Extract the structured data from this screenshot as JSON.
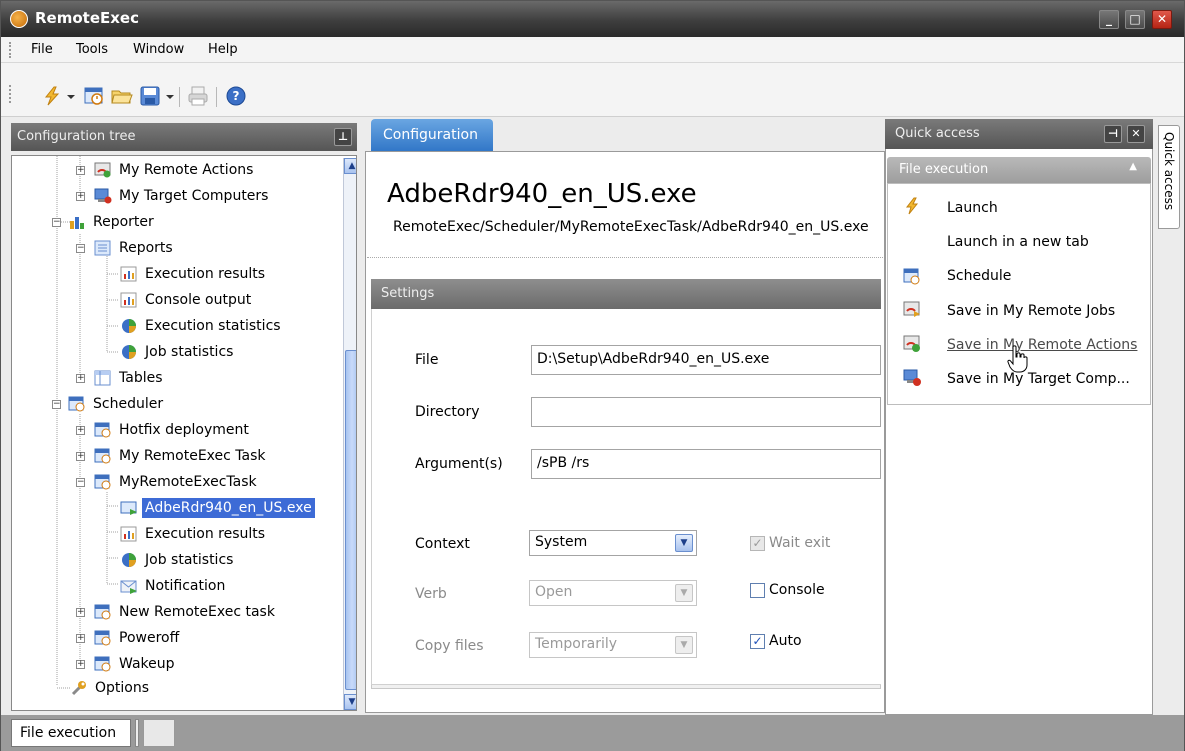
{
  "window": {
    "title": "RemoteExec"
  },
  "menu": [
    "File",
    "Tools",
    "Window",
    "Help"
  ],
  "tree_panel": {
    "title": "Configuration tree"
  },
  "tree": [
    {
      "label": "My Remote Actions"
    },
    {
      "label": "My Target Computers"
    },
    {
      "label": "Reporter"
    },
    {
      "label": "Reports"
    },
    {
      "label": "Execution results"
    },
    {
      "label": "Console output"
    },
    {
      "label": "Execution statistics"
    },
    {
      "label": "Job statistics"
    },
    {
      "label": "Tables"
    },
    {
      "label": "Scheduler"
    },
    {
      "label": "Hotfix deployment"
    },
    {
      "label": "My RemoteExec Task"
    },
    {
      "label": "MyRemoteExecTask"
    },
    {
      "label": "AdbeRdr940_en_US.exe"
    },
    {
      "label": "Execution results"
    },
    {
      "label": "Job statistics"
    },
    {
      "label": "Notification"
    },
    {
      "label": "New RemoteExec task"
    },
    {
      "label": "Poweroff"
    },
    {
      "label": "Wakeup"
    },
    {
      "label": "Options"
    }
  ],
  "config": {
    "tab_label": "Configuration",
    "title": "AdbeRdr940_en_US.exe",
    "path": "RemoteExec/Scheduler/MyRemoteExecTask/AdbeRdr940_en_US.exe",
    "settings_label": "Settings",
    "file_label": "File",
    "file_value": "D:\\Setup\\AdbeRdr940_en_US.exe",
    "directory_label": "Directory",
    "directory_value": "",
    "arguments_label": "Argument(s)",
    "arguments_value": "/sPB /rs",
    "context_label": "Context",
    "context_value": "System",
    "verb_label": "Verb",
    "verb_value": "Open",
    "copy_label": "Copy files",
    "copy_value": "Temporarily",
    "wait_exit_label": "Wait exit",
    "console_label": "Console",
    "auto_label": "Auto"
  },
  "quick_access": {
    "title": "Quick access",
    "section": "File execution",
    "items": [
      "Launch",
      "Launch in a new tab",
      "Schedule",
      "Save in My Remote Jobs",
      "Save in My Remote Actions",
      "Save in My Target Comp..."
    ],
    "side_tab": "Quick access"
  },
  "status": {
    "tab": "File execution"
  },
  "colors": {
    "accent": "#2e74c6",
    "selection": "#3d6bd6",
    "close": "#c0301f"
  },
  "icons": [
    "lightning-icon",
    "schedule-icon",
    "folder-open-icon",
    "save-icon",
    "print-icon",
    "help-icon"
  ]
}
